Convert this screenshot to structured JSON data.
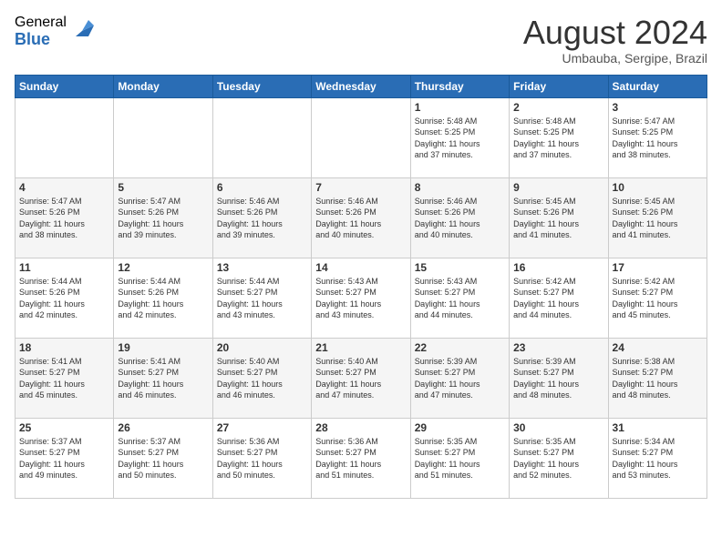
{
  "logo": {
    "general": "General",
    "blue": "Blue"
  },
  "title": {
    "month_year": "August 2024",
    "location": "Umbauba, Sergipe, Brazil"
  },
  "days_of_week": [
    "Sunday",
    "Monday",
    "Tuesday",
    "Wednesday",
    "Thursday",
    "Friday",
    "Saturday"
  ],
  "weeks": [
    [
      {
        "day": "",
        "info": ""
      },
      {
        "day": "",
        "info": ""
      },
      {
        "day": "",
        "info": ""
      },
      {
        "day": "",
        "info": ""
      },
      {
        "day": "1",
        "info": "Sunrise: 5:48 AM\nSunset: 5:25 PM\nDaylight: 11 hours\nand 37 minutes."
      },
      {
        "day": "2",
        "info": "Sunrise: 5:48 AM\nSunset: 5:25 PM\nDaylight: 11 hours\nand 37 minutes."
      },
      {
        "day": "3",
        "info": "Sunrise: 5:47 AM\nSunset: 5:25 PM\nDaylight: 11 hours\nand 38 minutes."
      }
    ],
    [
      {
        "day": "4",
        "info": "Sunrise: 5:47 AM\nSunset: 5:26 PM\nDaylight: 11 hours\nand 38 minutes."
      },
      {
        "day": "5",
        "info": "Sunrise: 5:47 AM\nSunset: 5:26 PM\nDaylight: 11 hours\nand 39 minutes."
      },
      {
        "day": "6",
        "info": "Sunrise: 5:46 AM\nSunset: 5:26 PM\nDaylight: 11 hours\nand 39 minutes."
      },
      {
        "day": "7",
        "info": "Sunrise: 5:46 AM\nSunset: 5:26 PM\nDaylight: 11 hours\nand 40 minutes."
      },
      {
        "day": "8",
        "info": "Sunrise: 5:46 AM\nSunset: 5:26 PM\nDaylight: 11 hours\nand 40 minutes."
      },
      {
        "day": "9",
        "info": "Sunrise: 5:45 AM\nSunset: 5:26 PM\nDaylight: 11 hours\nand 41 minutes."
      },
      {
        "day": "10",
        "info": "Sunrise: 5:45 AM\nSunset: 5:26 PM\nDaylight: 11 hours\nand 41 minutes."
      }
    ],
    [
      {
        "day": "11",
        "info": "Sunrise: 5:44 AM\nSunset: 5:26 PM\nDaylight: 11 hours\nand 42 minutes."
      },
      {
        "day": "12",
        "info": "Sunrise: 5:44 AM\nSunset: 5:26 PM\nDaylight: 11 hours\nand 42 minutes."
      },
      {
        "day": "13",
        "info": "Sunrise: 5:44 AM\nSunset: 5:27 PM\nDaylight: 11 hours\nand 43 minutes."
      },
      {
        "day": "14",
        "info": "Sunrise: 5:43 AM\nSunset: 5:27 PM\nDaylight: 11 hours\nand 43 minutes."
      },
      {
        "day": "15",
        "info": "Sunrise: 5:43 AM\nSunset: 5:27 PM\nDaylight: 11 hours\nand 44 minutes."
      },
      {
        "day": "16",
        "info": "Sunrise: 5:42 AM\nSunset: 5:27 PM\nDaylight: 11 hours\nand 44 minutes."
      },
      {
        "day": "17",
        "info": "Sunrise: 5:42 AM\nSunset: 5:27 PM\nDaylight: 11 hours\nand 45 minutes."
      }
    ],
    [
      {
        "day": "18",
        "info": "Sunrise: 5:41 AM\nSunset: 5:27 PM\nDaylight: 11 hours\nand 45 minutes."
      },
      {
        "day": "19",
        "info": "Sunrise: 5:41 AM\nSunset: 5:27 PM\nDaylight: 11 hours\nand 46 minutes."
      },
      {
        "day": "20",
        "info": "Sunrise: 5:40 AM\nSunset: 5:27 PM\nDaylight: 11 hours\nand 46 minutes."
      },
      {
        "day": "21",
        "info": "Sunrise: 5:40 AM\nSunset: 5:27 PM\nDaylight: 11 hours\nand 47 minutes."
      },
      {
        "day": "22",
        "info": "Sunrise: 5:39 AM\nSunset: 5:27 PM\nDaylight: 11 hours\nand 47 minutes."
      },
      {
        "day": "23",
        "info": "Sunrise: 5:39 AM\nSunset: 5:27 PM\nDaylight: 11 hours\nand 48 minutes."
      },
      {
        "day": "24",
        "info": "Sunrise: 5:38 AM\nSunset: 5:27 PM\nDaylight: 11 hours\nand 48 minutes."
      }
    ],
    [
      {
        "day": "25",
        "info": "Sunrise: 5:37 AM\nSunset: 5:27 PM\nDaylight: 11 hours\nand 49 minutes."
      },
      {
        "day": "26",
        "info": "Sunrise: 5:37 AM\nSunset: 5:27 PM\nDaylight: 11 hours\nand 50 minutes."
      },
      {
        "day": "27",
        "info": "Sunrise: 5:36 AM\nSunset: 5:27 PM\nDaylight: 11 hours\nand 50 minutes."
      },
      {
        "day": "28",
        "info": "Sunrise: 5:36 AM\nSunset: 5:27 PM\nDaylight: 11 hours\nand 51 minutes."
      },
      {
        "day": "29",
        "info": "Sunrise: 5:35 AM\nSunset: 5:27 PM\nDaylight: 11 hours\nand 51 minutes."
      },
      {
        "day": "30",
        "info": "Sunrise: 5:35 AM\nSunset: 5:27 PM\nDaylight: 11 hours\nand 52 minutes."
      },
      {
        "day": "31",
        "info": "Sunrise: 5:34 AM\nSunset: 5:27 PM\nDaylight: 11 hours\nand 53 minutes."
      }
    ]
  ]
}
